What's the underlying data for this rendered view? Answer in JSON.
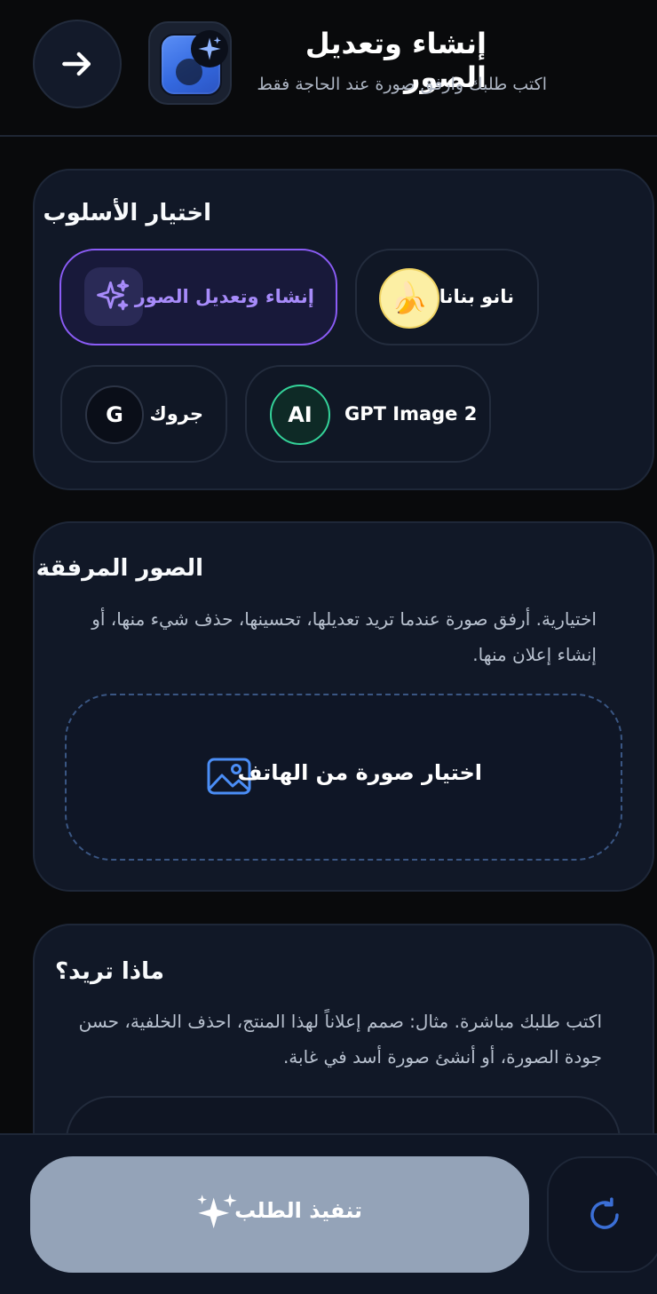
{
  "header": {
    "title": "إنشاء وتعديل الصور",
    "subtitle": "اكتب طلبك وارفق صورة عند الحاجة فقط",
    "back_icon": "arrow-right-icon",
    "app_icon": "image-sparkle-icon"
  },
  "style_section": {
    "title": "اختيار الأسلوب",
    "options": [
      {
        "label": "إنشاء وتعديل الصور",
        "icon": "sparkles-icon",
        "selected": true
      },
      {
        "label": "نانو بنانا",
        "icon": "banana-icon",
        "icon_text": "🍌",
        "selected": false
      },
      {
        "label": "جروك",
        "icon": "grok-icon",
        "icon_text": "G",
        "selected": false
      },
      {
        "label": "GPT Image 2",
        "icon": "ai-icon",
        "icon_text": "AI",
        "selected": false
      }
    ]
  },
  "attachments_section": {
    "title": "الصور المرفقة",
    "description_line1": "اختيارية. أرفق صورة عندما تريد تعديلها، تحسينها، حذف شيء منها، أو",
    "description_line2": "إنشاء إعلان منها.",
    "upload_label": "اختيار صورة من الهاتف",
    "upload_icon": "image-icon"
  },
  "prompt_section": {
    "title": "ماذا تريد؟",
    "description_line1": "اكتب طلبك مباشرة. مثال: صمم إعلاناً لهذا المنتج، احذف الخلفية، حسن",
    "description_line2": "جودة الصورة، أو أنشئ صورة أسد في غابة."
  },
  "footer": {
    "submit_label": "تنفيذ الطلب",
    "submit_icon": "sparkles-icon",
    "refresh_icon": "refresh-icon"
  },
  "colors": {
    "background": "#090a0c",
    "card": "#111827",
    "accent_purple": "#8b5cf6",
    "accent_blue": "#3b82f6",
    "submit_disabled": "#94a3b8"
  }
}
